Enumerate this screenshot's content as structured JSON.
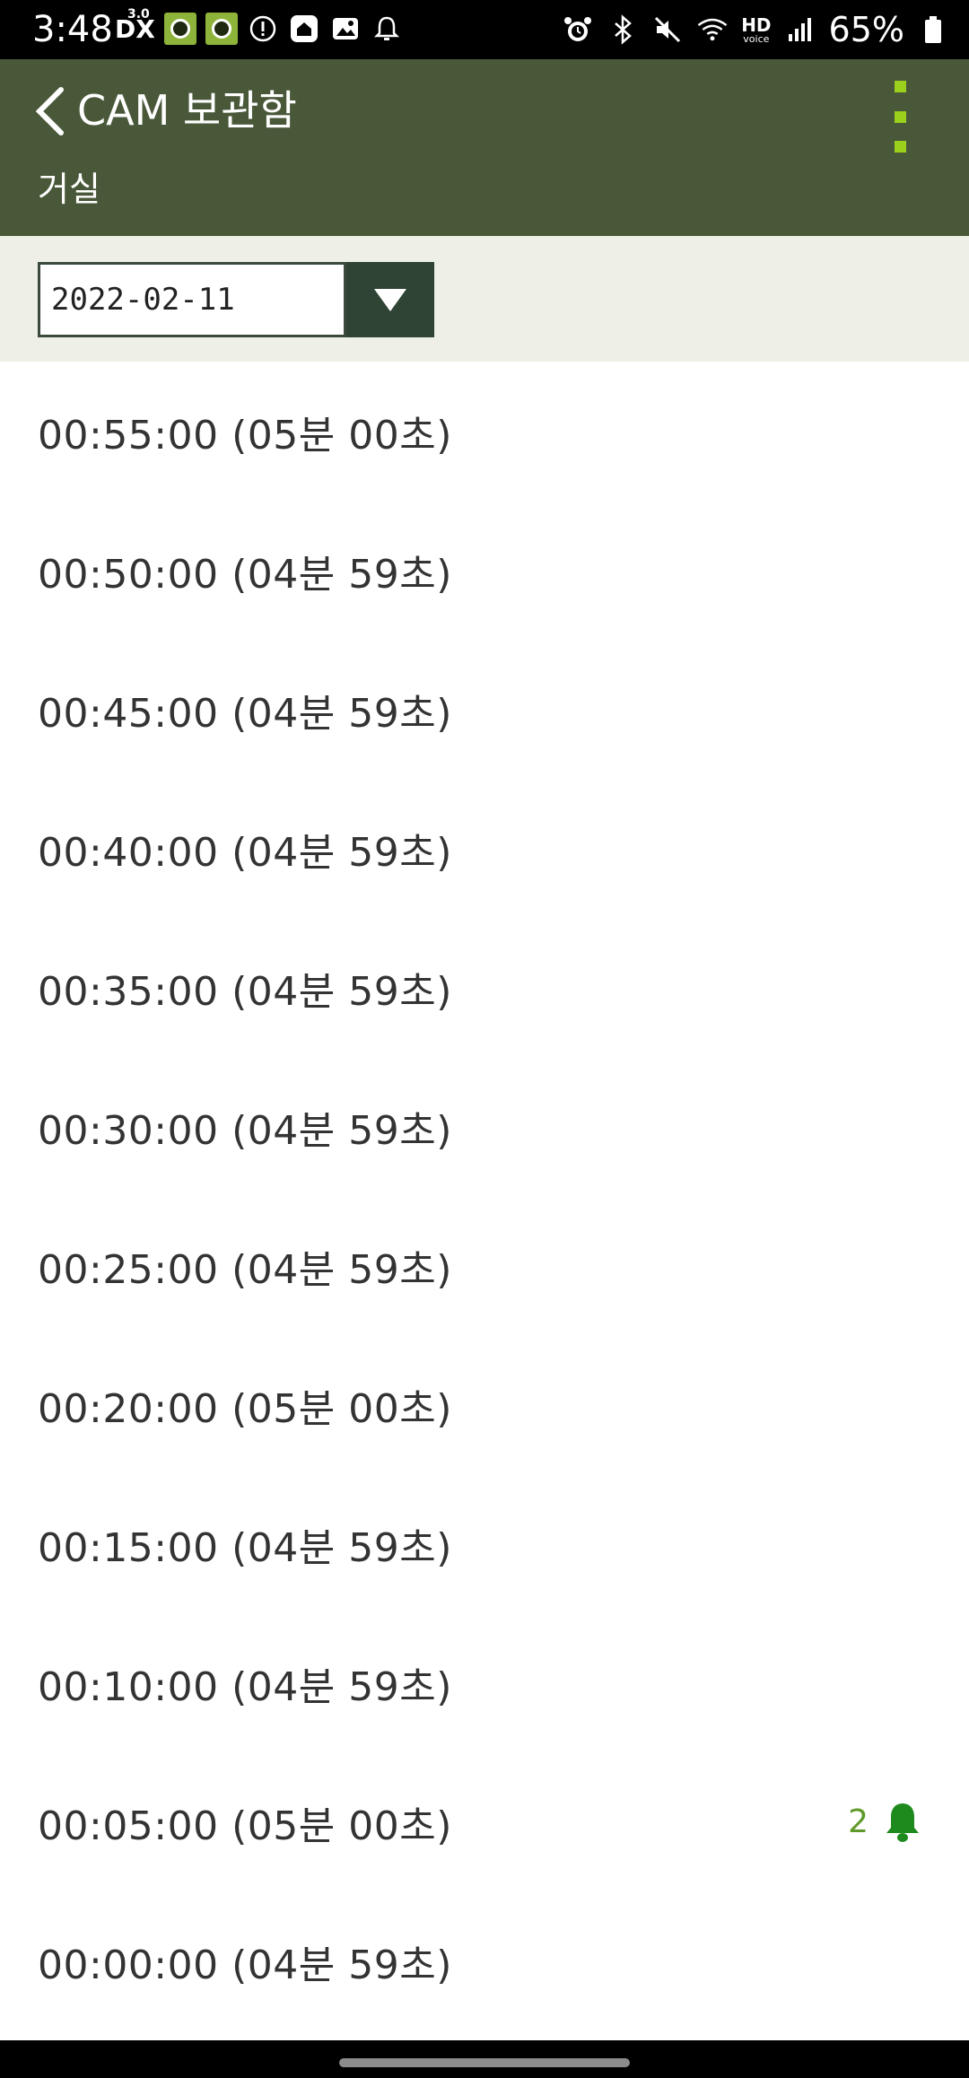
{
  "status_bar": {
    "time": "3:48",
    "dx_label": "DX",
    "dx_super": "3.0",
    "battery_text": "65%",
    "hd_label": "HD",
    "voice_label": "voice"
  },
  "app_bar": {
    "title": "CAM 보관함",
    "subtitle": "거실"
  },
  "date_selector": {
    "value": "2022-02-11"
  },
  "records": [
    {
      "label": "00:55:00 (05분 00초)",
      "alert_count": ""
    },
    {
      "label": "00:50:00 (04분 59초)",
      "alert_count": ""
    },
    {
      "label": "00:45:00 (04분 59초)",
      "alert_count": ""
    },
    {
      "label": "00:40:00 (04분 59초)",
      "alert_count": ""
    },
    {
      "label": "00:35:00 (04분 59초)",
      "alert_count": ""
    },
    {
      "label": "00:30:00 (04분 59초)",
      "alert_count": ""
    },
    {
      "label": "00:25:00 (04분 59초)",
      "alert_count": ""
    },
    {
      "label": "00:20:00 (05분 00초)",
      "alert_count": ""
    },
    {
      "label": "00:15:00 (04분 59초)",
      "alert_count": ""
    },
    {
      "label": "00:10:00 (04분 59초)",
      "alert_count": ""
    },
    {
      "label": "00:05:00 (05분 00초)",
      "alert_count": "2"
    },
    {
      "label": "00:00:00 (04분 59초)",
      "alert_count": ""
    }
  ],
  "colors": {
    "app_bar": "#4a583a",
    "date_bar": "#eeefe6",
    "accent": "#9bd01c",
    "alert": "#1e8a1e"
  }
}
